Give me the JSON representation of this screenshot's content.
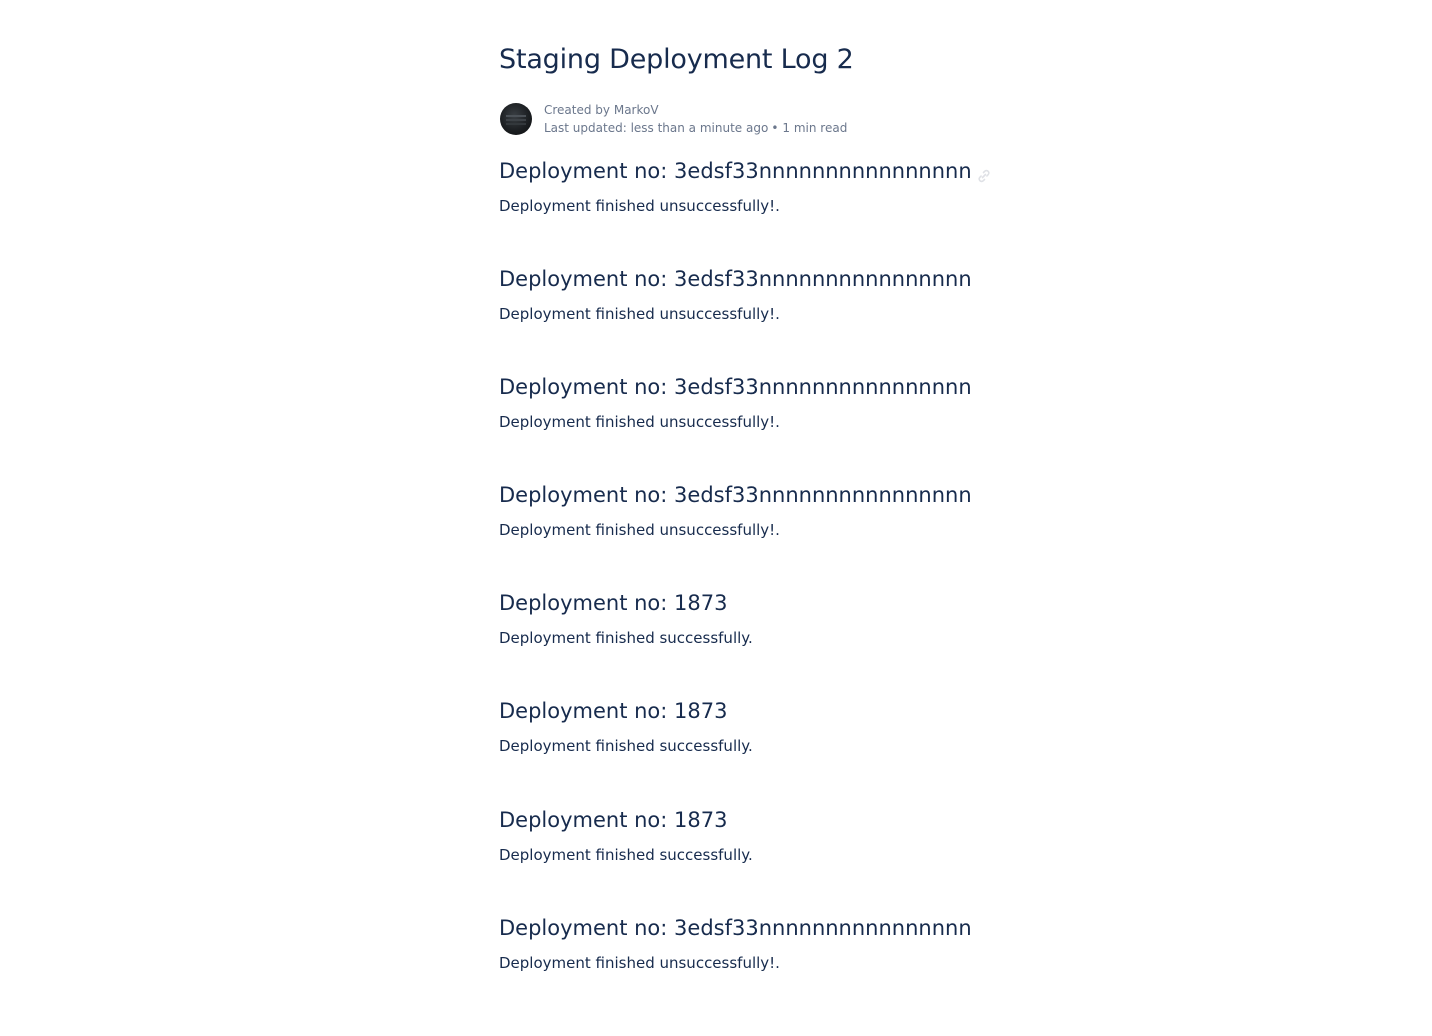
{
  "page": {
    "title": "Staging Deployment Log 2"
  },
  "byline": {
    "created_by": "Created by MarkoV",
    "last_updated": "Last updated: less than a minute ago",
    "separator": "•",
    "read_time": "1 min read",
    "avatar_icon": "user-avatar"
  },
  "entries": [
    {
      "heading": "Deployment no: 3edsf33nnnnnnnnnnnnnnnn",
      "text": "Deployment finished unsuccessfully!."
    },
    {
      "heading": "Deployment no: 3edsf33nnnnnnnnnnnnnnnn",
      "text": "Deployment finished unsuccessfully!."
    },
    {
      "heading": "Deployment no: 3edsf33nnnnnnnnnnnnnnnn",
      "text": "Deployment finished unsuccessfully!."
    },
    {
      "heading": "Deployment no: 3edsf33nnnnnnnnnnnnnnnn",
      "text": "Deployment finished unsuccessfully!."
    },
    {
      "heading": "Deployment no: 1873",
      "text": "Deployment finished successfully."
    },
    {
      "heading": "Deployment no: 1873",
      "text": "Deployment finished successfully."
    },
    {
      "heading": "Deployment no: 1873",
      "text": "Deployment finished successfully."
    },
    {
      "heading": "Deployment no: 3edsf33nnnnnnnnnnnnnnnn",
      "text": "Deployment finished unsuccessfully!."
    }
  ],
  "icons": {
    "heading_anchor": "link-icon"
  },
  "colors": {
    "text": "#172b4d",
    "meta": "#6b778c",
    "link_icon": "#dfe1e6"
  }
}
